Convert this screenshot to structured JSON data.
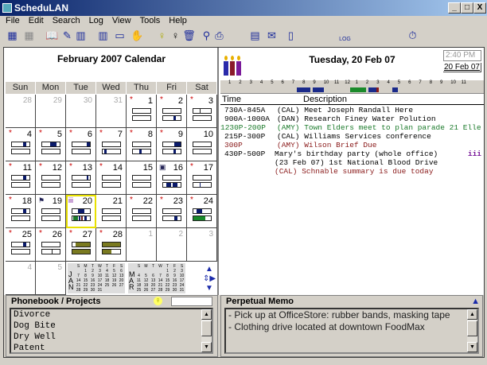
{
  "window": {
    "title": "ScheduLAN",
    "minimize": "_",
    "maximize": "□",
    "close": "X"
  },
  "menu": [
    "File",
    "Edit",
    "Search",
    "Log",
    "View",
    "Tools",
    "Help"
  ],
  "toolbar": {
    "log_label": "LOG",
    "clock_icon": "stopwatch-icon"
  },
  "calendar": {
    "title": "February 2007 Calendar",
    "weekdays": [
      "Sun",
      "Mon",
      "Tue",
      "Wed",
      "Thu",
      "Fri",
      "Sat"
    ],
    "today": "20",
    "cells": [
      {
        "d": "28",
        "dim": true
      },
      {
        "d": "29",
        "dim": true
      },
      {
        "d": "30",
        "dim": true
      },
      {
        "d": "31",
        "dim": true
      },
      {
        "d": "1",
        "star": true,
        "bars": true
      },
      {
        "d": "2",
        "star": true,
        "bars": true,
        "b2": [
          [
            0.6,
            0.75,
            "#0a1a6a"
          ]
        ]
      },
      {
        "d": "3",
        "star": true,
        "bars": true,
        "b1": [
          [
            0.35,
            0.4,
            "#222"
          ]
        ]
      },
      {
        "d": "4",
        "star": true,
        "bars": true,
        "b1": [
          [
            0.65,
            0.8,
            "#0a1a6a"
          ]
        ]
      },
      {
        "d": "5",
        "star": true,
        "bars": true,
        "b1": [
          [
            0.45,
            0.8,
            "#0a1a6a"
          ]
        ]
      },
      {
        "d": "6",
        "star": true,
        "bars": true,
        "b1": [
          [
            0.8,
            1,
            "#0a1a6a"
          ]
        ]
      },
      {
        "d": "7",
        "star": true,
        "bars": true,
        "b2": [
          [
            0.1,
            0.25,
            "#0a1a6a"
          ]
        ]
      },
      {
        "d": "8",
        "star": true,
        "bars": true,
        "b2": [
          [
            0.35,
            0.5,
            "#0a1a6a"
          ]
        ]
      },
      {
        "d": "9",
        "star": true,
        "bars": true,
        "b1": [
          [
            0.65,
            1,
            "#0a1a6a"
          ]
        ],
        "b2": [
          [
            0.6,
            0.75,
            "#0a1a6a"
          ]
        ]
      },
      {
        "d": "10",
        "bars": true
      },
      {
        "d": "11",
        "star": true,
        "bars": true,
        "b1": [
          [
            0.65,
            0.8,
            "#0a1a6a"
          ]
        ]
      },
      {
        "d": "12",
        "star": true,
        "bars": true
      },
      {
        "d": "13",
        "star": true,
        "bars": true,
        "b1": [
          [
            0.8,
            0.9,
            "#0a1a6a"
          ]
        ]
      },
      {
        "d": "14",
        "star": true,
        "bars": true
      },
      {
        "d": "15",
        "bars": true
      },
      {
        "d": "16",
        "icon": "bus-icon",
        "bars": true,
        "b2": [
          [
            0.2,
            0.45,
            "#0a1a6a"
          ],
          [
            0.55,
            0.8,
            "#0a1a6a"
          ]
        ]
      },
      {
        "d": "17",
        "star": true,
        "bars": true,
        "b2": [
          [
            0.35,
            0.4,
            "#0a1a6a"
          ]
        ]
      },
      {
        "d": "18",
        "star": true,
        "bars": true,
        "b1": [
          [
            0.65,
            0.8,
            "#0a1a6a"
          ]
        ]
      },
      {
        "d": "19",
        "icon": "flag-icon",
        "bars": true
      },
      {
        "d": "20",
        "icon": "candles-icon",
        "bars": true,
        "b1": [
          [
            0.3,
            0.7,
            "#0a1a6a"
          ]
        ],
        "b2": [
          [
            0.05,
            0.3,
            "#1a7a2a"
          ],
          [
            0.35,
            0.45,
            "#0a1a6a"
          ],
          [
            0.5,
            0.6,
            "#6a1a1a"
          ],
          [
            0.7,
            0.8,
            "#0a1a6a"
          ]
        ]
      },
      {
        "d": "21",
        "bars": true
      },
      {
        "d": "22",
        "star": true,
        "bars": true
      },
      {
        "d": "23",
        "star": true,
        "bars": true,
        "b2": [
          [
            0.65,
            0.8,
            "#0a1a6a"
          ]
        ]
      },
      {
        "d": "24",
        "star": true,
        "bars": true,
        "b1": [
          [
            0.2,
            0.5,
            "#0a1a6a"
          ]
        ],
        "b2": [
          [
            0,
            0.7,
            "#1a8a2a"
          ]
        ]
      },
      {
        "d": "25",
        "star": true,
        "bars": true,
        "b1": [
          [
            0.65,
            0.8,
            "#0a1a6a"
          ]
        ]
      },
      {
        "d": "26",
        "star": true,
        "bars": true,
        "b2": [
          [
            0.55,
            0.6,
            "#222"
          ]
        ]
      },
      {
        "d": "27",
        "star": true,
        "bars": true,
        "b1": [
          [
            0.2,
            1,
            "#7a7a20"
          ]
        ],
        "b2": [
          [
            0,
            1,
            "#7a7a20"
          ]
        ]
      },
      {
        "d": "28",
        "star": true,
        "bars": true,
        "b1": [
          [
            0,
            1,
            "#7a7a20"
          ]
        ],
        "b2": [
          [
            0,
            0.5,
            "#7a7a20"
          ]
        ]
      },
      {
        "d": "1",
        "dim": true
      },
      {
        "d": "2",
        "dim": true
      },
      {
        "d": "3",
        "dim": true
      },
      {
        "d": "4",
        "dim": true
      },
      {
        "d": "5",
        "dim": true
      }
    ],
    "mini_jan": {
      "label": [
        "J",
        "A",
        "N"
      ],
      "head": [
        "S",
        "M",
        "T",
        "W",
        "T",
        "F",
        "S"
      ],
      "weeks": [
        [
          "",
          "1",
          "2",
          "3",
          "4",
          "5",
          "6"
        ],
        [
          "7",
          "8",
          "9",
          "10",
          "11",
          "12",
          "13"
        ],
        [
          "14",
          "15",
          "16",
          "17",
          "18",
          "19",
          "20"
        ],
        [
          "21",
          "22",
          "23",
          "24",
          "25",
          "26",
          "27"
        ],
        [
          "28",
          "29",
          "30",
          "31",
          "",
          "",
          ""
        ]
      ]
    },
    "mini_mar": {
      "label": [
        "M",
        "A",
        "R"
      ],
      "head": [
        "S",
        "M",
        "T",
        "W",
        "T",
        "F",
        "S"
      ],
      "weeks": [
        [
          "",
          "",
          "",
          "",
          "1",
          "2",
          "3"
        ],
        [
          "4",
          "5",
          "6",
          "7",
          "8",
          "9",
          "10"
        ],
        [
          "11",
          "12",
          "13",
          "14",
          "15",
          "16",
          "17"
        ],
        [
          "18",
          "19",
          "20",
          "21",
          "22",
          "23",
          "24"
        ],
        [
          "25",
          "26",
          "27",
          "28",
          "29",
          "30",
          "31"
        ]
      ]
    }
  },
  "day": {
    "title": "Tuesday, 20 Feb 07",
    "time": "2:40 PM",
    "date_link": "20 Feb 07",
    "hours": [
      "1",
      "2",
      "3",
      "4",
      "5",
      "6",
      "7",
      "8",
      "9",
      "10",
      "11",
      "12",
      "1",
      "2",
      "3",
      "4",
      "5",
      "6",
      "7",
      "8",
      "9",
      "10",
      "11"
    ],
    "col_time": "Time",
    "col_desc": "Description",
    "events": [
      {
        "time": "730A-845A",
        "desc": "(CAL) Meet Joseph Randall Here",
        "color": "#000000"
      },
      {
        "time": "900A-1000A",
        "desc": "(DAN) Research Finey Water Polution",
        "color": "#000000"
      },
      {
        "time": "1230P-200P",
        "desc": "(AMY) Town Elders meet to plan parade 21 Elle",
        "color": "#1a7a2a"
      },
      {
        "time": "215P-300P",
        "desc": "(CAL) Williams Services conference",
        "color": "#000000"
      },
      {
        "time": "300P",
        "desc": "(AMY) Wilson Brief Due",
        "color": "#8a1a1a"
      },
      {
        "time": "430P-500P",
        "desc": "Mary's birthday party (whole office)",
        "color": "#000000"
      },
      {
        "time": "",
        "desc": "(23 Feb 07) 1st National Blood Drive",
        "color": "#000000"
      },
      {
        "time": "",
        "desc": "(CAL) Schnable summary is due today",
        "color": "#8a1a1a"
      }
    ]
  },
  "phonebook": {
    "title": "Phonebook / Projects",
    "search": "",
    "items": [
      "Divorce",
      "Dog Bite",
      "Dry Well",
      "Patent"
    ]
  },
  "memo": {
    "title": "Perpetual Memo",
    "lines": [
      "- Pick up at OfficeStore:  rubber bands, masking tape",
      "- Clothing drive located at downtown FoodMax"
    ]
  }
}
